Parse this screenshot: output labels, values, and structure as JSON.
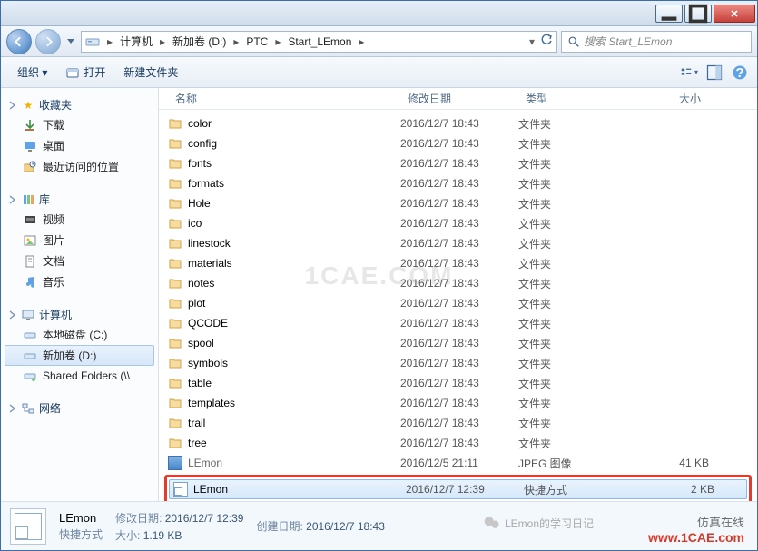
{
  "titlebar": {
    "minimize": "–",
    "maximize": "□",
    "close": "✕"
  },
  "breadcrumb": {
    "segments": [
      "计算机",
      "新加卷 (D:)",
      "PTC",
      "Start_LEmon"
    ]
  },
  "search": {
    "placeholder": "搜索 Start_LEmon"
  },
  "toolbar": {
    "organize": "组织 ▾",
    "open": "打开",
    "newfolder": "新建文件夹"
  },
  "sidebar": {
    "favorites": {
      "label": "收藏夹",
      "items": [
        "下载",
        "桌面",
        "最近访问的位置"
      ]
    },
    "libraries": {
      "label": "库",
      "items": [
        "视频",
        "图片",
        "文档",
        "音乐"
      ]
    },
    "computer": {
      "label": "计算机",
      "items": [
        "本地磁盘 (C:)",
        "新加卷 (D:)",
        "Shared Folders (\\\\"
      ]
    },
    "network": {
      "label": "网络"
    }
  },
  "columns": {
    "name": "名称",
    "date": "修改日期",
    "type": "类型",
    "size": "大小"
  },
  "files": [
    {
      "name": "color",
      "date": "2016/12/7 18:43",
      "type": "文件夹",
      "size": ""
    },
    {
      "name": "config",
      "date": "2016/12/7 18:43",
      "type": "文件夹",
      "size": ""
    },
    {
      "name": "fonts",
      "date": "2016/12/7 18:43",
      "type": "文件夹",
      "size": ""
    },
    {
      "name": "formats",
      "date": "2016/12/7 18:43",
      "type": "文件夹",
      "size": ""
    },
    {
      "name": "Hole",
      "date": "2016/12/7 18:43",
      "type": "文件夹",
      "size": ""
    },
    {
      "name": "ico",
      "date": "2016/12/7 18:43",
      "type": "文件夹",
      "size": ""
    },
    {
      "name": "linestock",
      "date": "2016/12/7 18:43",
      "type": "文件夹",
      "size": ""
    },
    {
      "name": "materials",
      "date": "2016/12/7 18:43",
      "type": "文件夹",
      "size": ""
    },
    {
      "name": "notes",
      "date": "2016/12/7 18:43",
      "type": "文件夹",
      "size": ""
    },
    {
      "name": "plot",
      "date": "2016/12/7 18:43",
      "type": "文件夹",
      "size": ""
    },
    {
      "name": "QCODE",
      "date": "2016/12/7 18:43",
      "type": "文件夹",
      "size": ""
    },
    {
      "name": "spool",
      "date": "2016/12/7 18:43",
      "type": "文件夹",
      "size": ""
    },
    {
      "name": "symbols",
      "date": "2016/12/7 18:43",
      "type": "文件夹",
      "size": ""
    },
    {
      "name": "table",
      "date": "2016/12/7 18:43",
      "type": "文件夹",
      "size": ""
    },
    {
      "name": "templates",
      "date": "2016/12/7 18:43",
      "type": "文件夹",
      "size": ""
    },
    {
      "name": "trail",
      "date": "2016/12/7 18:43",
      "type": "文件夹",
      "size": ""
    },
    {
      "name": "tree",
      "date": "2016/12/7 18:43",
      "type": "文件夹",
      "size": ""
    }
  ],
  "cutfile": {
    "name": "LEmon",
    "date": "2016/12/5 21:11",
    "type": "JPEG 图像",
    "size": "41 KB"
  },
  "selected": {
    "name": "LEmon",
    "date": "2016/12/7 12:39",
    "type": "快捷方式",
    "size": "2 KB"
  },
  "details": {
    "name": "LEmon",
    "type": "快捷方式",
    "mod_label": "修改日期:",
    "mod_value": "2016/12/7 12:39",
    "created_label": "创建日期:",
    "created_value": "2016/12/7 18:43",
    "size_label": "大小:",
    "size_value": "1.19 KB"
  },
  "watermark": {
    "center": "1CAE.COM",
    "brand1": "仿真在线",
    "brand2": "www.1CAE.com",
    "wechat": "LEmon的学习日记"
  }
}
